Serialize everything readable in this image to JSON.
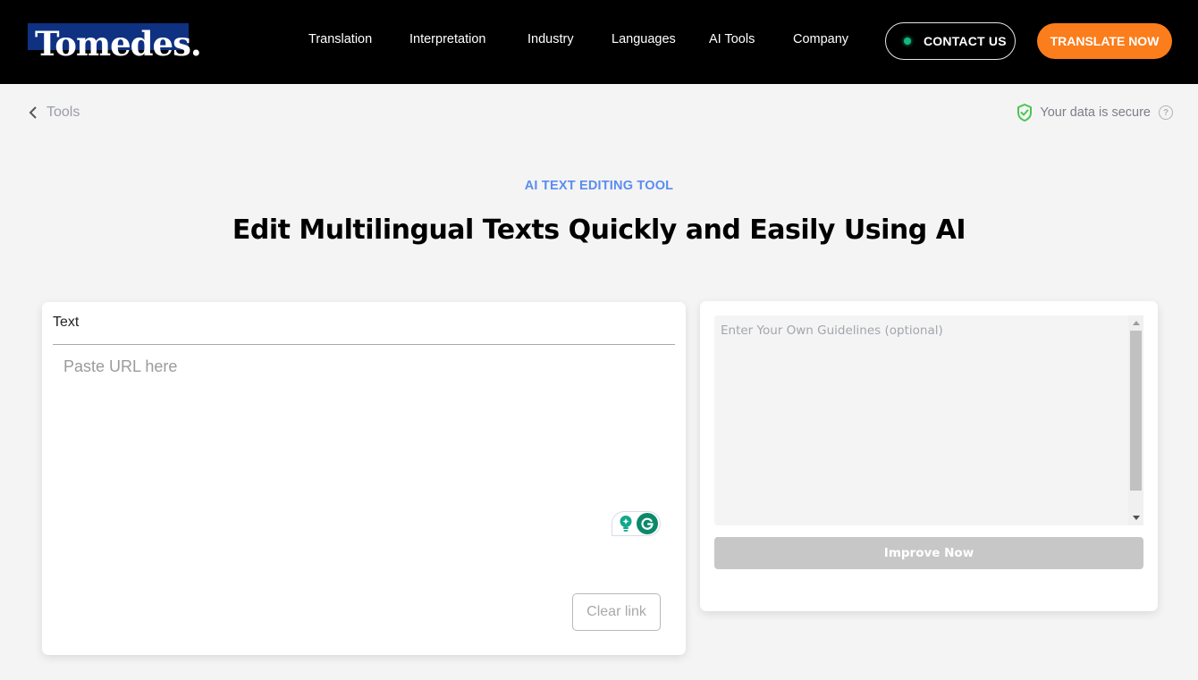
{
  "header": {
    "logo_text": "Tomedes.",
    "nav": [
      {
        "label": "Translation"
      },
      {
        "label": "Interpretation"
      },
      {
        "label": "Industry"
      },
      {
        "label": "Languages"
      },
      {
        "label": "AI Tools"
      },
      {
        "label": "Company"
      }
    ],
    "contact_label": "CONTACT US",
    "translate_label": "TRANSLATE NOW"
  },
  "breadcrumb": {
    "back_label": "Tools",
    "secure_label": "Your data is secure",
    "help_glyph": "?"
  },
  "hero": {
    "eyebrow": "AI TEXT EDITING TOOL",
    "title": "Edit Multilingual Texts Quickly and Easily Using AI"
  },
  "left_panel": {
    "label": "Text",
    "input_value": "",
    "input_placeholder": "Paste URL here",
    "clear_label": "Clear link"
  },
  "right_panel": {
    "guidelines_value": "",
    "guidelines_placeholder": "Enter Your Own Guidelines (optional)",
    "improve_label": "Improve Now"
  },
  "colors": {
    "header_bg": "#000000",
    "logo_blue": "#0e3182",
    "accent_orange": "#fb7d1b",
    "eyebrow_blue": "#5b8def",
    "status_green": "#10b981",
    "shield_green": "#4cc552",
    "disabled_gray": "#c7c7c7",
    "grammarly_green": "#0b8a6b"
  }
}
